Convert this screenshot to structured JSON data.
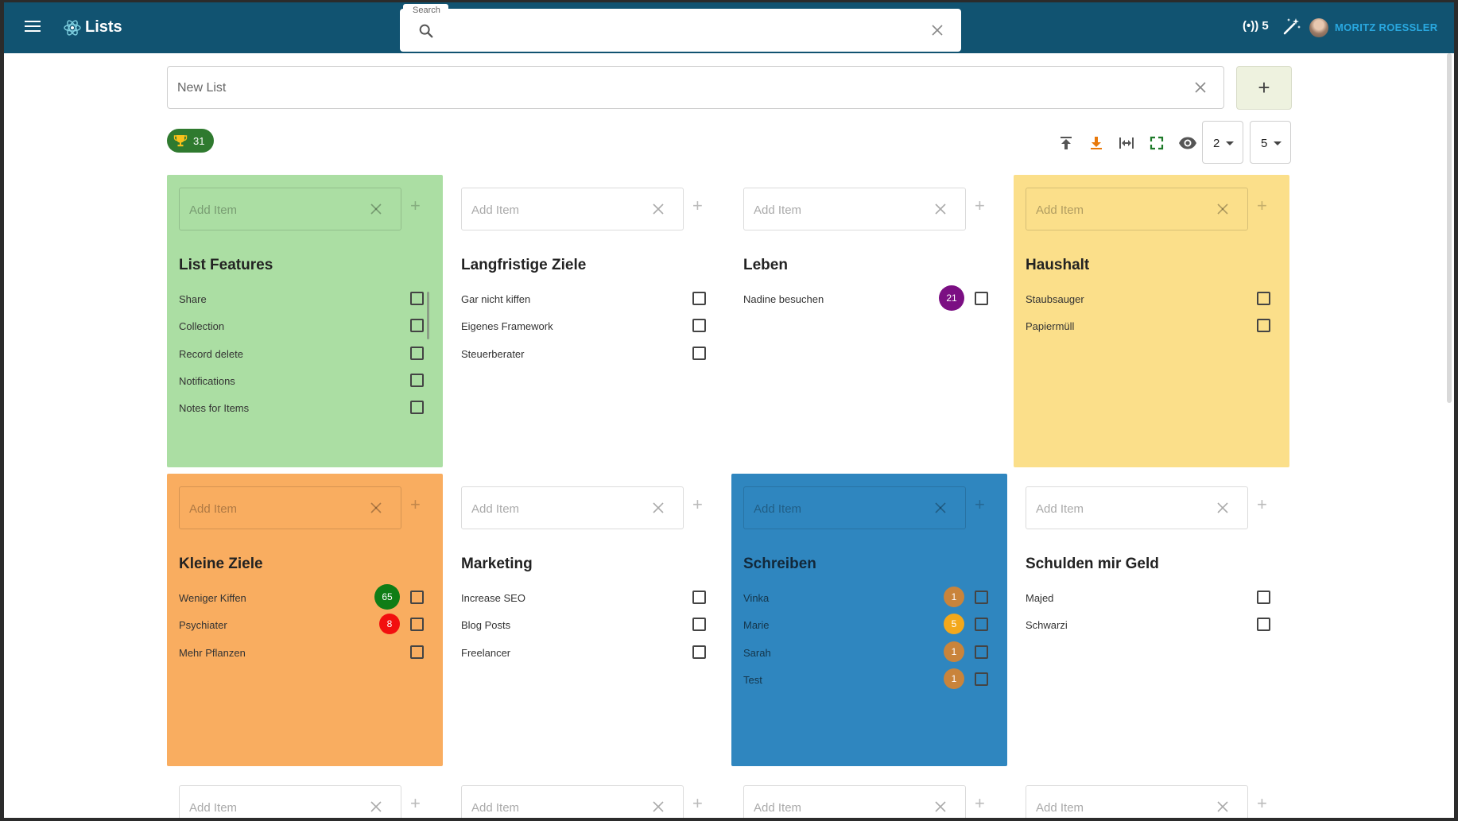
{
  "header": {
    "title": "Lists",
    "search_label": "Search",
    "search_placeholder": "",
    "signal_count": "(•)) 5",
    "user_name": "MORITZ ROESSLER"
  },
  "new_list": {
    "placeholder": "New List",
    "add_label": "+"
  },
  "toolbar": {
    "trophy_count": "31",
    "columns_value": "2",
    "rows_value": "5"
  },
  "add_item_placeholder": "Add Item",
  "add_plus": "+",
  "cards": [
    {
      "title": "List Features",
      "color": "#abdea3",
      "items": [
        {
          "label": "Share"
        },
        {
          "label": "Collection"
        },
        {
          "label": "Record delete"
        },
        {
          "label": "Notifications"
        },
        {
          "label": "Notes for Items"
        }
      ]
    },
    {
      "title": "Langfristige Ziele",
      "color": "#ffffff",
      "items": [
        {
          "label": "Gar nicht kiffen"
        },
        {
          "label": "Eigenes Framework"
        },
        {
          "label": "Steuerberater"
        }
      ]
    },
    {
      "title": "Leben",
      "color": "#ffffff",
      "items": [
        {
          "label": "Nadine besuchen",
          "badge": "21",
          "badge_color": "#7b0f83"
        }
      ]
    },
    {
      "title": "Haushalt",
      "color": "#fbdf8a",
      "items": [
        {
          "label": "Staubsauger"
        },
        {
          "label": "Papiermüll"
        }
      ]
    },
    {
      "title": "Kleine Ziele",
      "color": "#f9ad60",
      "items": [
        {
          "label": "Weniger Kiffen",
          "badge": "65",
          "badge_color": "#0f7d16"
        },
        {
          "label": "Psychiater",
          "badge": "8",
          "badge_color": "#f20f0f"
        },
        {
          "label": "Mehr Pflanzen"
        }
      ]
    },
    {
      "title": "Marketing",
      "color": "#ffffff",
      "items": [
        {
          "label": "Increase SEO"
        },
        {
          "label": "Blog Posts"
        },
        {
          "label": "Freelancer"
        }
      ]
    },
    {
      "title": "Schreiben",
      "color": "#2f86bf",
      "items": [
        {
          "label": "Vinka",
          "badge": "1",
          "badge_color": "#c9843b"
        },
        {
          "label": "Marie",
          "badge": "5",
          "badge_color": "#f3a81b"
        },
        {
          "label": "Sarah",
          "badge": "1",
          "badge_color": "#c9843b"
        },
        {
          "label": "Test",
          "badge": "1",
          "badge_color": "#c9843b"
        }
      ]
    },
    {
      "title": "Schulden mir Geld",
      "color": "#ffffff",
      "items": [
        {
          "label": "Majed"
        },
        {
          "label": "Schwarzi"
        }
      ]
    }
  ],
  "icons": {
    "menu": "menu-icon",
    "logo": "atom-logo-icon",
    "search": "search-icon",
    "clear": "close-icon",
    "signal": "broadcast-icon",
    "wand": "magic-wand-icon",
    "trophy": "trophy-icon",
    "upload": "upload-icon",
    "download": "download-icon",
    "width": "expand-width-icon",
    "fullscreen": "fullscreen-icon",
    "visibility": "eye-icon"
  }
}
